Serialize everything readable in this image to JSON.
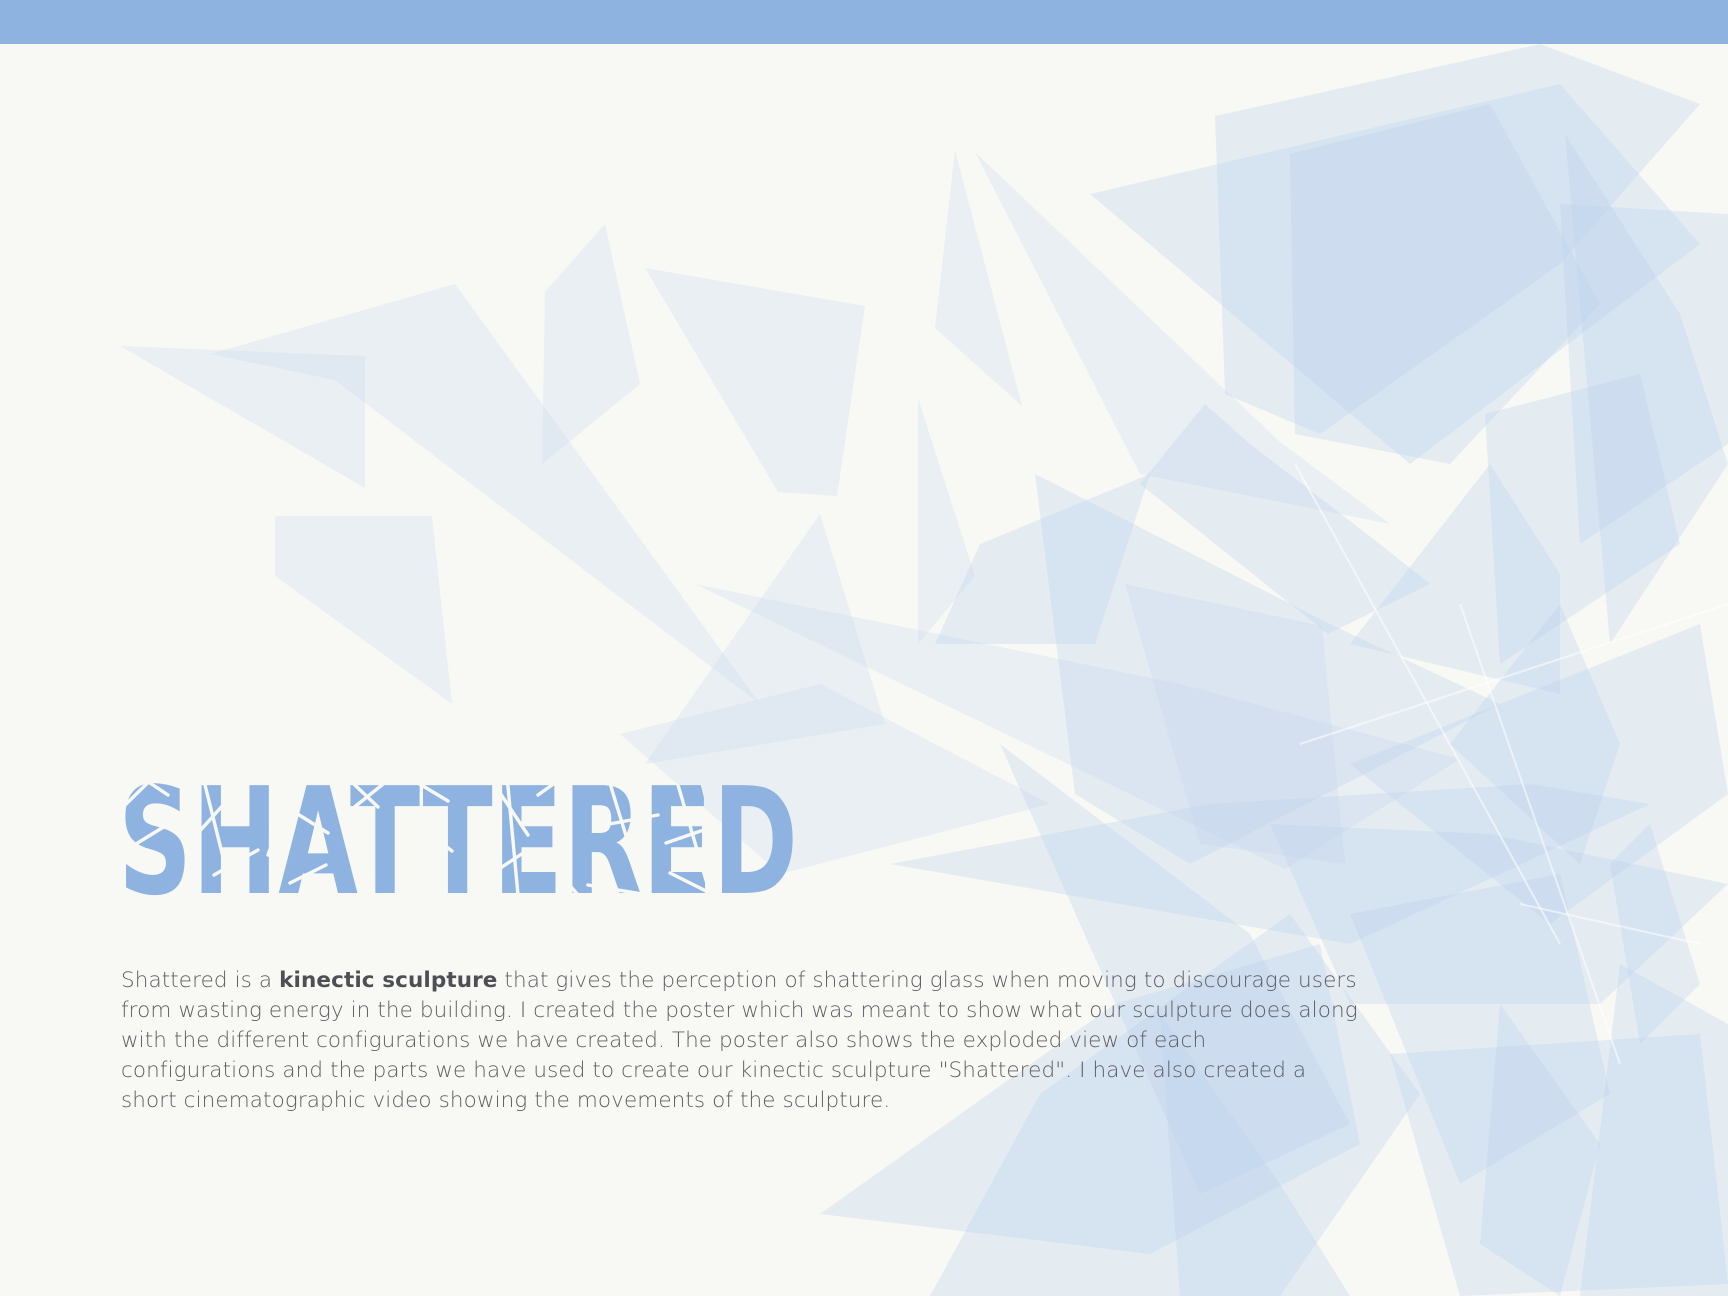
{
  "title": "SHATTERED",
  "description": {
    "before": "Shattered is a ",
    "bold": "kinectic sculpture",
    "after": " that gives the perception of shattering glass when moving to discourage users from wasting energy in the building. I created the poster which was meant to show what our sculpture does along with the different configurations we have created. The poster also shows the exploded view of each configurations and the parts we have used to create our kinectic sculpture \"Shattered\". I have also created a short cinematographic video showing the movements of the sculpture."
  },
  "colors": {
    "accent": "#8fb3e0",
    "background": "#f8f9f5",
    "text": "#5d5d63"
  }
}
